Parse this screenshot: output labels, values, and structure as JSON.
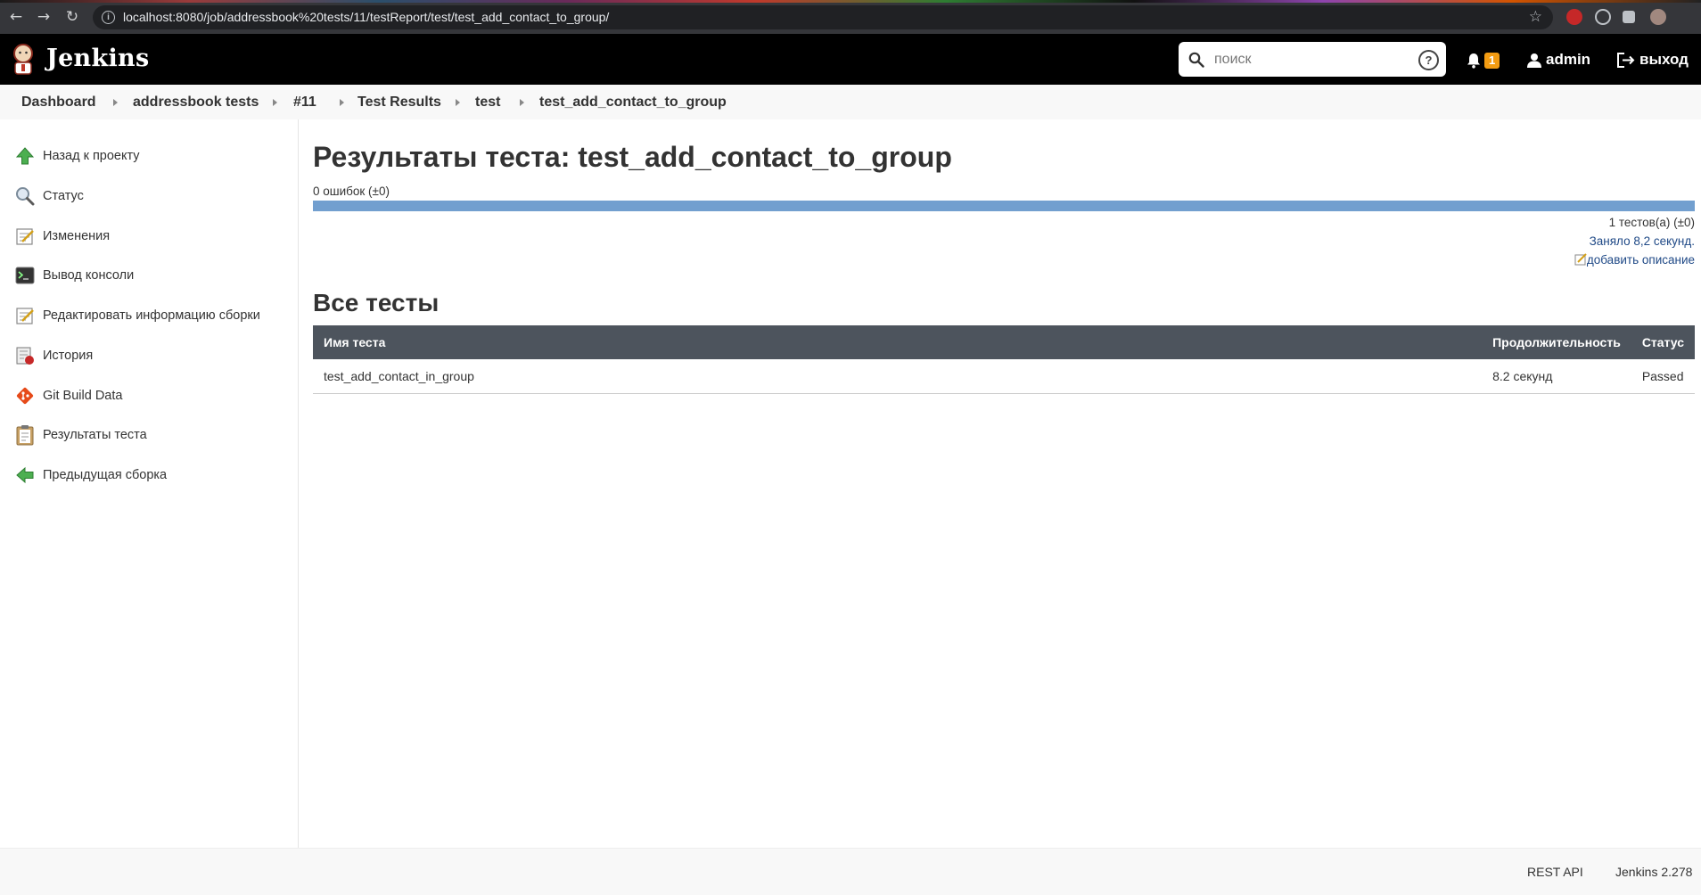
{
  "browser": {
    "url": "localhost:8080/job/addressbook%20tests/11/testReport/test/test_add_contact_to_group/"
  },
  "header": {
    "brand": "Jenkins",
    "search_placeholder": "поиск",
    "notifications_count": "1",
    "user": "admin",
    "logout": "выход"
  },
  "breadcrumb": [
    "Dashboard",
    "addressbook tests",
    "#11",
    "Test Results",
    "test",
    "test_add_contact_to_group"
  ],
  "sidebar": {
    "items": [
      {
        "label": "Назад к проекту",
        "icon": "up-arrow-icon"
      },
      {
        "label": "Статус",
        "icon": "magnifier-icon"
      },
      {
        "label": "Изменения",
        "icon": "notepad-icon"
      },
      {
        "label": "Вывод консоли",
        "icon": "terminal-icon"
      },
      {
        "label": "Редактировать информацию сборки",
        "icon": "notepad-edit-icon"
      },
      {
        "label": "История",
        "icon": "history-icon"
      },
      {
        "label": "Git Build Data",
        "icon": "git-icon"
      },
      {
        "label": "Результаты теста",
        "icon": "clipboard-icon"
      },
      {
        "label": "Предыдущая сборка",
        "icon": "left-arrow-icon"
      }
    ]
  },
  "main": {
    "title": "Результаты теста: test_add_contact_to_group",
    "failures": "0 ошибок (±0)",
    "progress_passed_fraction": 1.0,
    "tests_count": "1 тестов(а) (±0)",
    "duration": "Заняло 8,2 секунд.",
    "add_description": "добавить описание",
    "all_tests_heading": "Все тесты",
    "table": {
      "headers": [
        "Имя теста",
        "Продолжительность",
        "Статус"
      ],
      "rows": [
        {
          "name": "test_add_contact_in_group",
          "duration": "8.2 секунд",
          "status": "Passed"
        }
      ]
    }
  },
  "footer": {
    "rest_api": "REST API",
    "version": "Jenkins 2.278"
  },
  "colors": {
    "header_bg": "#000000",
    "progress": "#729fcf",
    "table_header": "#4d545d",
    "link": "#204a87",
    "badge": "#f39c12"
  }
}
